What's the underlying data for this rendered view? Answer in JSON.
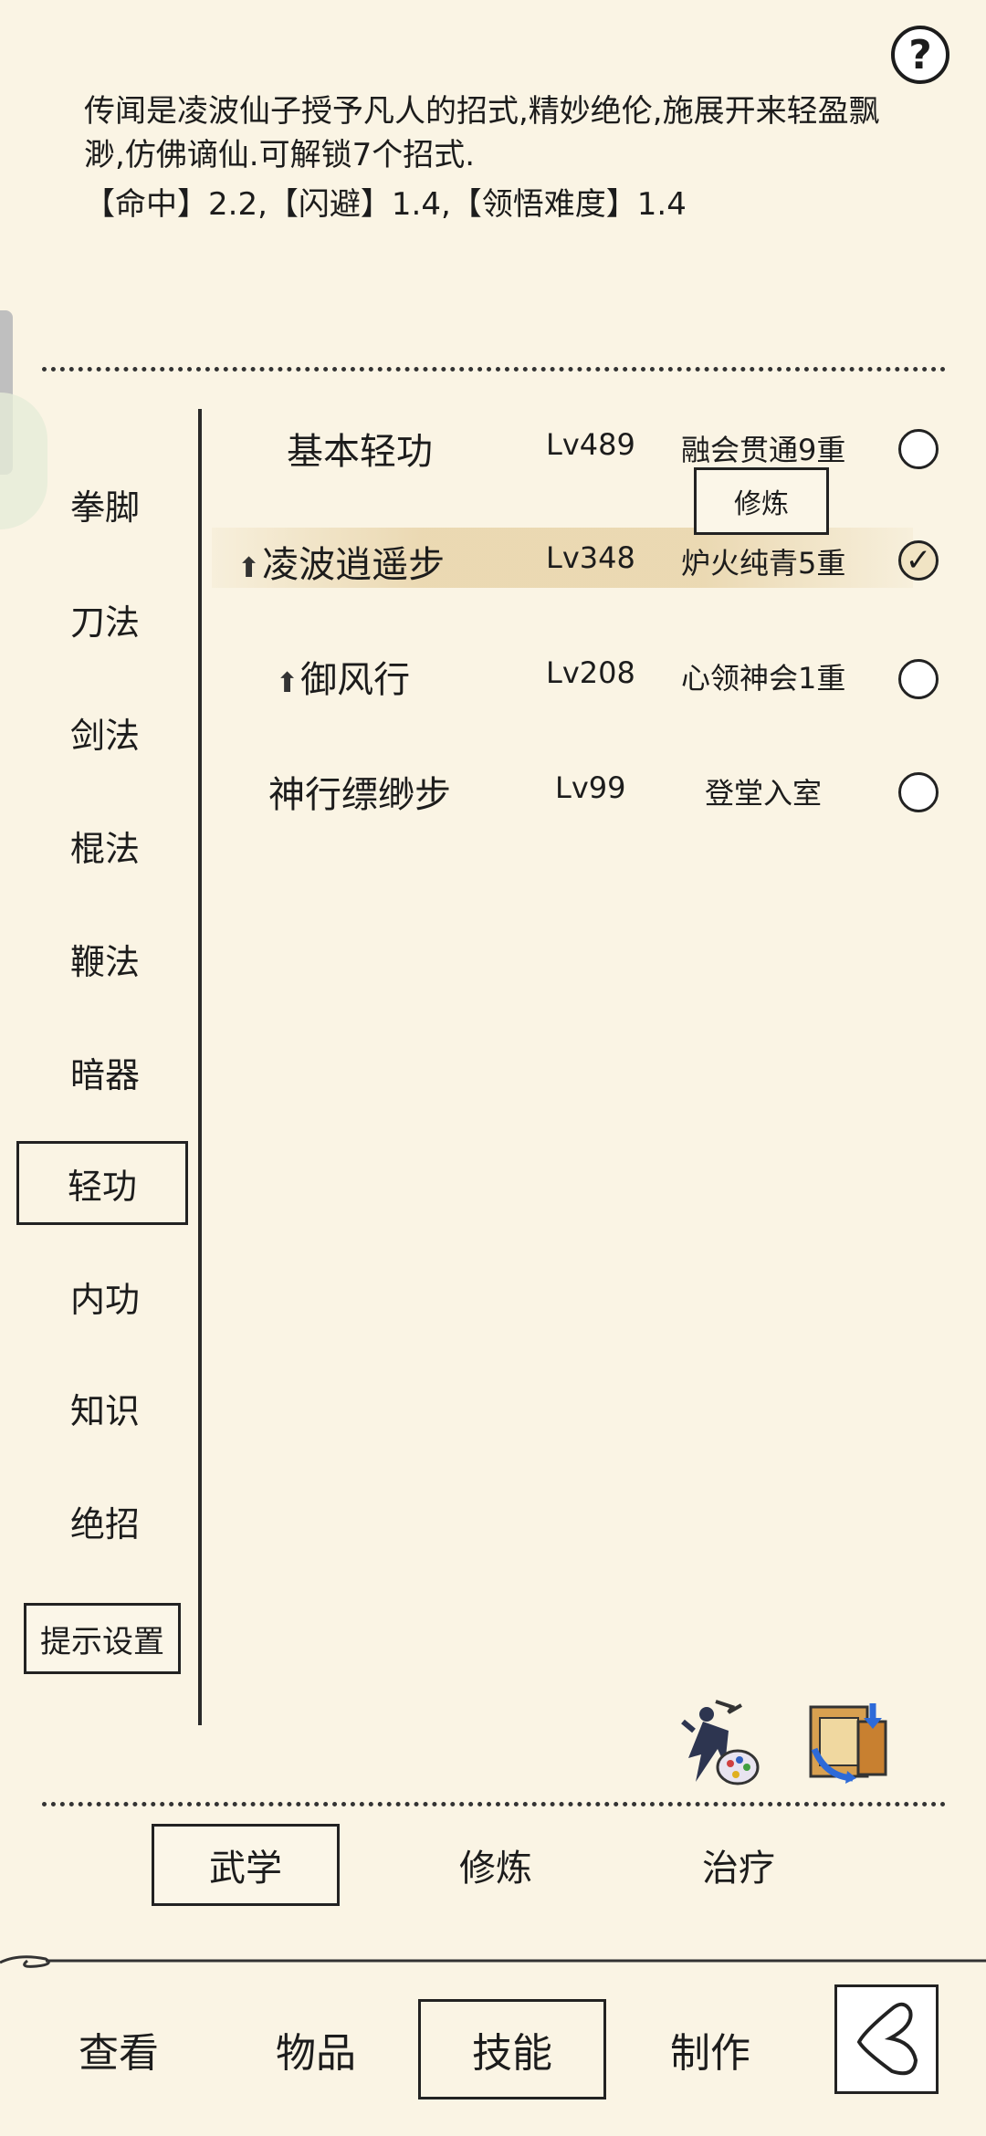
{
  "help": {
    "symbol": "?"
  },
  "description": {
    "text": "传闻是凌波仙子授予凡人的招式,精妙绝伦,施展开来轻盈飘渺,仿佛谪仙.可解锁7个招式.",
    "stats": "【命中】2.2,【闪避】1.4,【领悟难度】1.4"
  },
  "sidebar": {
    "items": [
      "拳脚",
      "刀法",
      "剑法",
      "棍法",
      "鞭法",
      "暗器",
      "轻功",
      "内功",
      "知识",
      "绝招"
    ],
    "active": "轻功",
    "tip_settings": "提示设置"
  },
  "skills": [
    {
      "name": "基本轻功",
      "level": "Lv489",
      "rank": "融会贯通9重",
      "upgrade": false,
      "checked": false
    },
    {
      "name": "凌波逍遥步",
      "level": "Lv348",
      "rank": "炉火纯青5重",
      "upgrade": true,
      "checked": true
    },
    {
      "name": "御风行",
      "level": "Lv208",
      "rank": "心领神会1重",
      "upgrade": true,
      "checked": false
    },
    {
      "name": "神行缥缈步",
      "level": "Lv99",
      "rank": "登堂入室",
      "upgrade": false,
      "checked": false
    }
  ],
  "popup": {
    "train_label": "修炼"
  },
  "sub_tabs": {
    "martial": "武学",
    "train": "修炼",
    "heal": "治疗",
    "active": "武学"
  },
  "bottom_nav": {
    "view": "查看",
    "items": "物品",
    "skills": "技能",
    "craft": "制作",
    "active": "技能"
  },
  "icons": {
    "warrior": "warrior-palette-icon",
    "book": "skill-book-icon",
    "back": "back-icon"
  },
  "colors": {
    "background": "#faf4e4",
    "ink": "#1c1c1c",
    "highlight": "#e8d4aa"
  }
}
